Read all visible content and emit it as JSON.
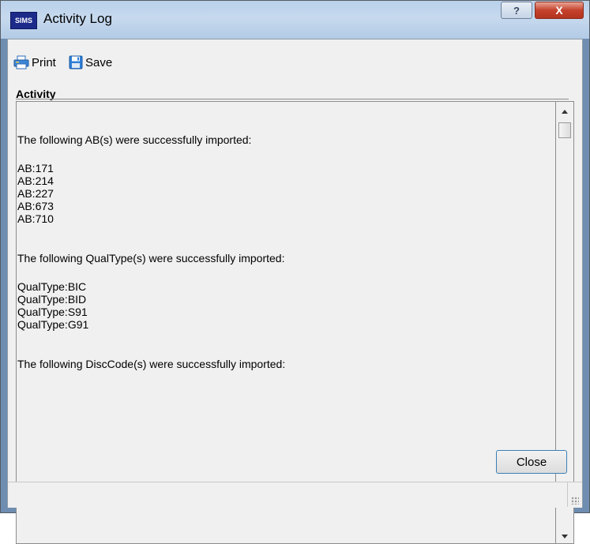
{
  "window": {
    "app_icon": "SIMS",
    "title": "Activity Log",
    "help_glyph": "?",
    "close_glyph": "X"
  },
  "toolbar": {
    "print_label": "Print",
    "save_label": "Save",
    "print_icon": "printer-icon",
    "save_icon": "floppy-disk-icon"
  },
  "panel": {
    "header": "Activity"
  },
  "log": {
    "sections": [
      {
        "heading": "The following AB(s) were successfully imported:",
        "items": [
          "AB:171",
          "AB:214",
          "AB:227",
          "AB:673",
          "AB:710"
        ]
      },
      {
        "heading": "The following QualType(s) were successfully imported:",
        "items": [
          "QualType:BIC",
          "QualType:BID",
          "QualType:S91",
          "QualType:G91"
        ]
      },
      {
        "heading": "The following DiscCode(s) were successfully imported:",
        "items": []
      }
    ]
  },
  "buttons": {
    "close_label": "Close"
  },
  "colors": {
    "accent": "#3b7fb5",
    "close_button_red": "#c4412d",
    "dialog_background": "#f0f0f0"
  }
}
